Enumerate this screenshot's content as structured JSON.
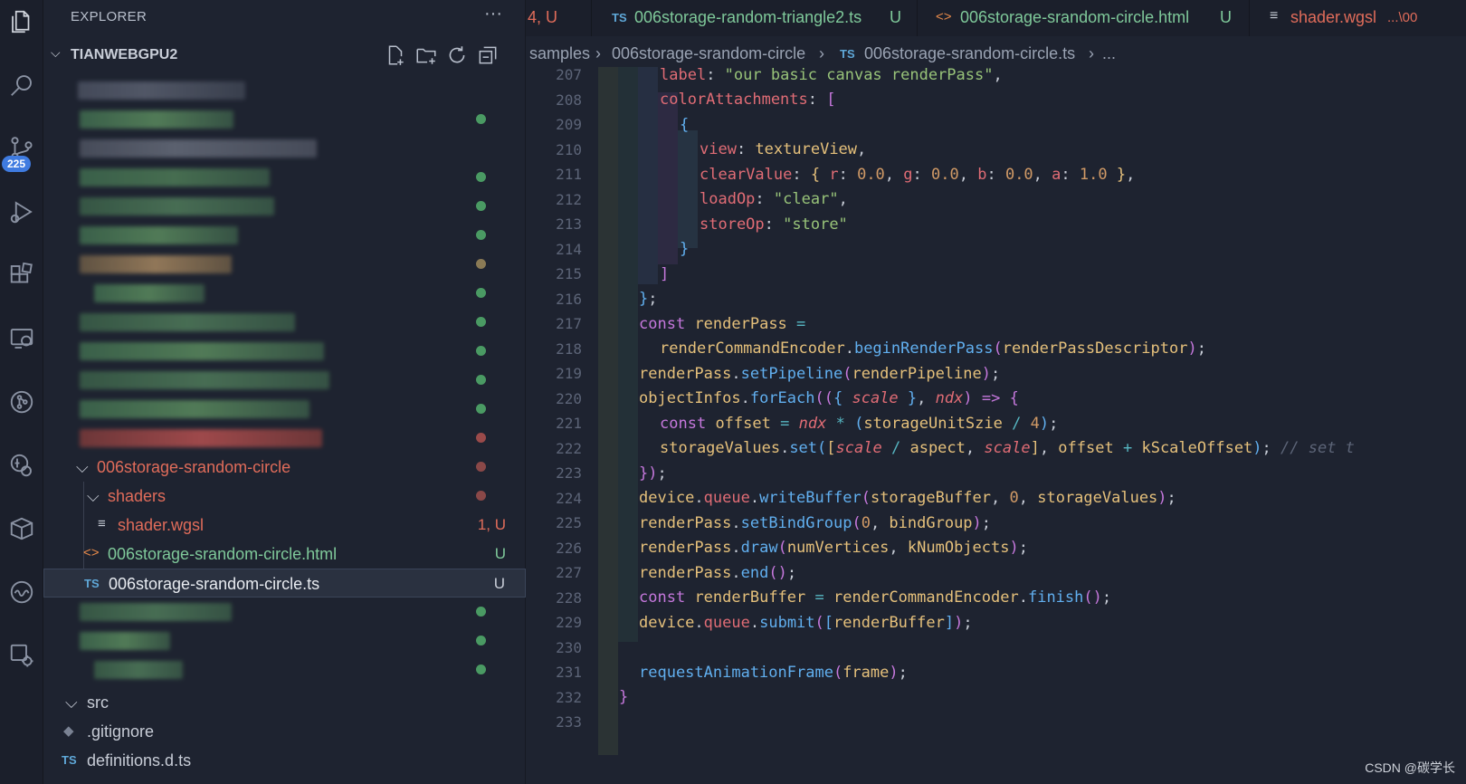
{
  "sidebar": {
    "header": "EXPLORER",
    "more": "···",
    "project": "TIANWEBGPU2",
    "tree": {
      "folder_circle": "006storage-srandom-circle",
      "folder_shaders": "shaders",
      "file_wgsl": "shader.wgsl",
      "file_wgsl_status": "1, U",
      "file_html": "006storage-srandom-circle.html",
      "file_html_status": "U",
      "file_ts": "006storage-srandom-circle.ts",
      "file_ts_status": "U",
      "folder_src": "src",
      "file_gitignore": ".gitignore",
      "file_defs": "definitions.d.ts"
    }
  },
  "activity": {
    "scm_badge": "225"
  },
  "tabs": [
    {
      "label": "4, U",
      "color": "#e06c5a"
    },
    {
      "icon": "TS",
      "label": "006storage-random-triangle2.ts",
      "status": "U",
      "color": "#7fc99a"
    },
    {
      "icon": "<>",
      "label": "006storage-srandom-circle.html",
      "status": "U",
      "color": "#7fc99a"
    },
    {
      "icon": "≡",
      "label": "shader.wgsl",
      "status": "...\\00",
      "color": "#e06c5a"
    }
  ],
  "breadcrumb": {
    "part1": "samples",
    "part2": "006storage-srandom-circle",
    "ts_icon": "TS",
    "part3": "006storage-srandom-circle.ts",
    "part4": "..."
  },
  "editor": {
    "line_numbers": [
      "207",
      "208",
      "209",
      "210",
      "211",
      "212",
      "213",
      "214",
      "215",
      "216",
      "217",
      "218",
      "219",
      "220",
      "221",
      "222",
      "223",
      "224",
      "225",
      "226",
      "227",
      "228",
      "229",
      "230",
      "231",
      "232",
      "233"
    ]
  },
  "watermark": "CSDN @碳学长"
}
